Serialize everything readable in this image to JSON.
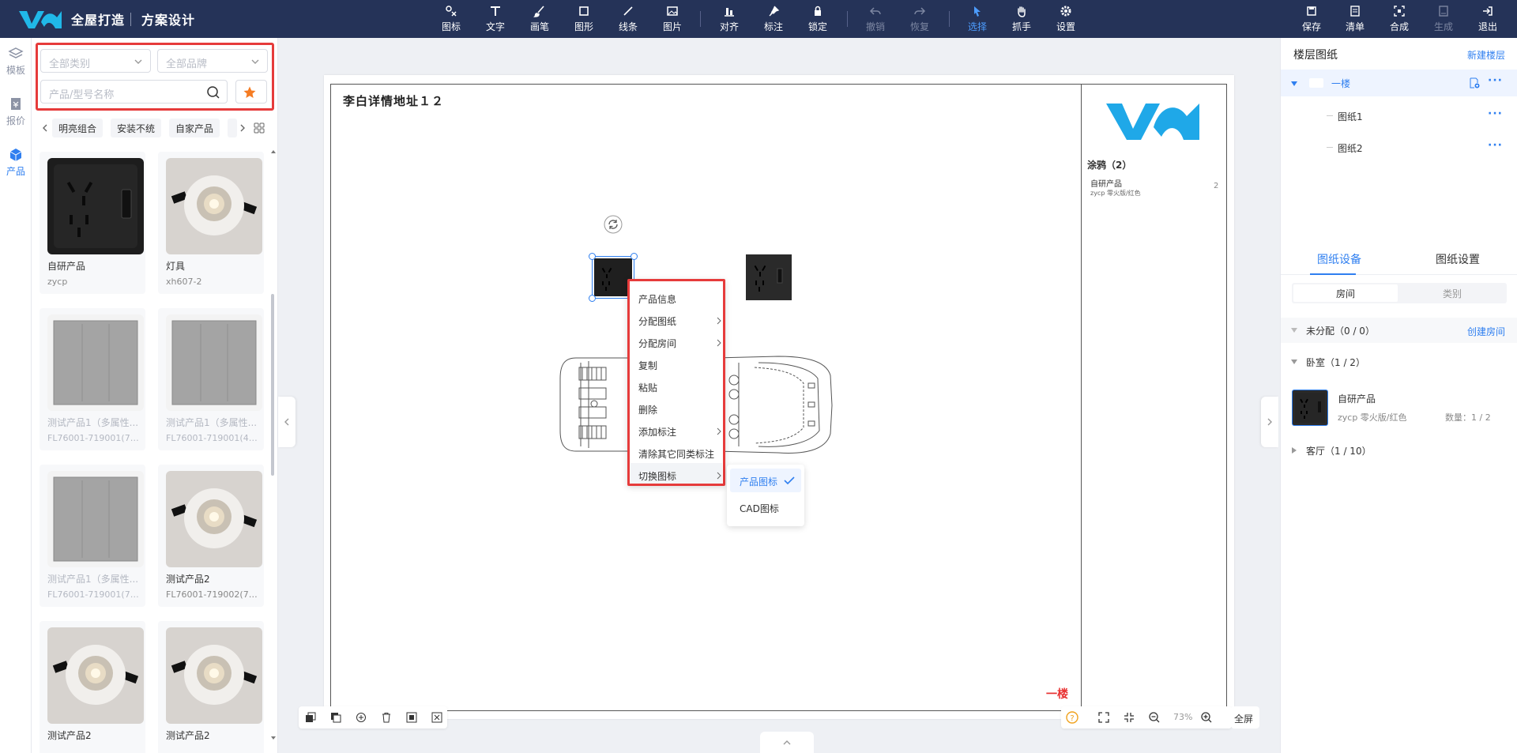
{
  "app": {
    "brand": "全屋打造",
    "module": "方案设计"
  },
  "toolbar": {
    "left": [
      {
        "label": "图标",
        "icon": "icon-tool-icon"
      },
      {
        "label": "文字",
        "icon": "text-tool-icon"
      },
      {
        "label": "画笔",
        "icon": "brush-icon"
      },
      {
        "label": "图形",
        "icon": "shape-icon"
      },
      {
        "label": "线条",
        "icon": "line-icon"
      },
      {
        "label": "图片",
        "icon": "image-icon"
      },
      {
        "label": "对齐",
        "icon": "align-icon"
      },
      {
        "label": "标注",
        "icon": "pin-icon"
      },
      {
        "label": "锁定",
        "icon": "lock-icon"
      },
      {
        "label": "撤销",
        "icon": "undo-icon",
        "disabled": true
      },
      {
        "label": "恢复",
        "icon": "redo-icon",
        "disabled": true
      },
      {
        "label": "选择",
        "icon": "cursor-icon",
        "active": true
      },
      {
        "label": "抓手",
        "icon": "hand-icon"
      },
      {
        "label": "设置",
        "icon": "gear-icon"
      }
    ],
    "right": [
      {
        "label": "保存",
        "icon": "save-icon"
      },
      {
        "label": "清单",
        "icon": "list-icon"
      },
      {
        "label": "合成",
        "icon": "compose-icon"
      },
      {
        "label": "生成",
        "icon": "generate-icon",
        "disabled": true
      },
      {
        "label": "退出",
        "icon": "exit-icon"
      }
    ]
  },
  "rail": [
    {
      "label": "模板",
      "icon": "layers-icon"
    },
    {
      "label": "报价",
      "icon": "quote-icon"
    },
    {
      "label": "产品",
      "icon": "cube-icon",
      "active": true
    }
  ],
  "filters": {
    "category_placeholder": "全部类别",
    "brand_placeholder": "全部品牌",
    "search_placeholder": "产品/型号名称"
  },
  "tags": [
    "明亮组合",
    "安装不统",
    "自家产品"
  ],
  "products": [
    {
      "name": "自研产品",
      "code": "zycp",
      "img": "socket",
      "disabled": false
    },
    {
      "name": "灯具",
      "code": "xh607-2",
      "img": "lamp",
      "disabled": false
    },
    {
      "name": "测试产品1（多属性...",
      "code": "FL76001-719001(719...",
      "img": "panel",
      "disabled": true
    },
    {
      "name": "测试产品1（多属性...",
      "code": "FL76001-719001(423...",
      "img": "panel",
      "disabled": true
    },
    {
      "name": "测试产品1（多属性...",
      "code": "FL76001-719001(718...",
      "img": "panel",
      "disabled": true
    },
    {
      "name": "测试产品2",
      "code": "FL76001-719002(719...",
      "img": "lamp",
      "disabled": false
    },
    {
      "name": "测试产品2",
      "code": "",
      "img": "lamp",
      "disabled": false
    },
    {
      "name": "测试产品2",
      "code": "",
      "img": "lamp",
      "disabled": false
    }
  ],
  "canvas": {
    "title": "李白详情地址１２",
    "legend_title": "涂鸦（2）",
    "legend_item_name": "自研产品",
    "legend_item_sub": "zycp 零火版/红色",
    "legend_item_count": "2",
    "floor_label": "一楼"
  },
  "context_menu": {
    "items": [
      {
        "label": "产品信息",
        "submenu": false
      },
      {
        "label": "分配图纸",
        "submenu": true
      },
      {
        "label": "分配房间",
        "submenu": true
      },
      {
        "label": "复制",
        "submenu": false
      },
      {
        "label": "粘贴",
        "submenu": false
      },
      {
        "label": "删除",
        "submenu": false
      },
      {
        "label": "添加标注",
        "submenu": true
      },
      {
        "label": "清除其它同类标注",
        "submenu": false
      },
      {
        "label": "切换图标",
        "submenu": true
      }
    ],
    "submenu": {
      "selected": "产品图标",
      "other": "CAD图标"
    }
  },
  "zoom": {
    "level": "73%",
    "fullscreen_label": "全屏"
  },
  "right_panel": {
    "title": "楼层图纸",
    "new_floor": "新建楼层",
    "floor": "一楼",
    "sheets": [
      "图纸1",
      "图纸2"
    ],
    "tabs": [
      "图纸设备",
      "图纸设置"
    ],
    "segments": [
      "房间",
      "类别"
    ],
    "unassigned": "未分配（0 / 0）",
    "create_room": "创建房间",
    "bedroom": "卧室（1 / 2）",
    "item": {
      "name": "自研产品",
      "sub": "zycp 零火版/红色",
      "qty": "数量：1 / 2"
    },
    "living": "客厅（1 / 10）"
  },
  "colors": {
    "topbar": "#253358",
    "accent": "#2f7ff0",
    "highlight": "#e63b3b",
    "floor_label": "#e83030"
  }
}
